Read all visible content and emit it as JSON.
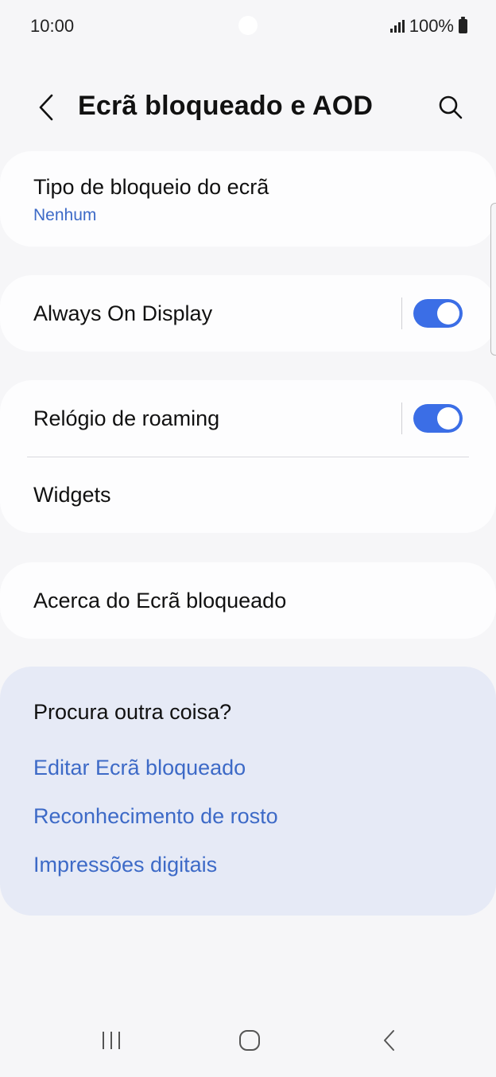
{
  "status_bar": {
    "time": "10:00",
    "battery_text": "100%"
  },
  "header": {
    "title": "Ecrã bloqueado e AOD"
  },
  "settings": {
    "lock_type": {
      "label": "Tipo de bloqueio do ecrã",
      "value": "Nenhum"
    },
    "always_on_display": {
      "label": "Always On Display",
      "enabled": true
    },
    "roaming_clock": {
      "label": "Relógio de roaming",
      "enabled": true
    },
    "widgets": {
      "label": "Widgets"
    },
    "about": {
      "label": "Acerca do Ecrã bloqueado"
    }
  },
  "suggestions": {
    "heading": "Procura outra coisa?",
    "links": [
      "Editar Ecrã bloqueado",
      "Reconhecimento de rosto",
      "Impressões digitais"
    ]
  },
  "colors": {
    "accent": "#3b6ee6",
    "link": "#3d6ac7",
    "background": "#f6f6f8",
    "card": "#fdfdfe",
    "suggest_bg": "#e6eaf6"
  },
  "icons": {
    "back": "chevron-left-icon",
    "search": "search-icon",
    "recents": "recents-icon",
    "home": "home-icon",
    "nav_back": "nav-back-icon"
  }
}
